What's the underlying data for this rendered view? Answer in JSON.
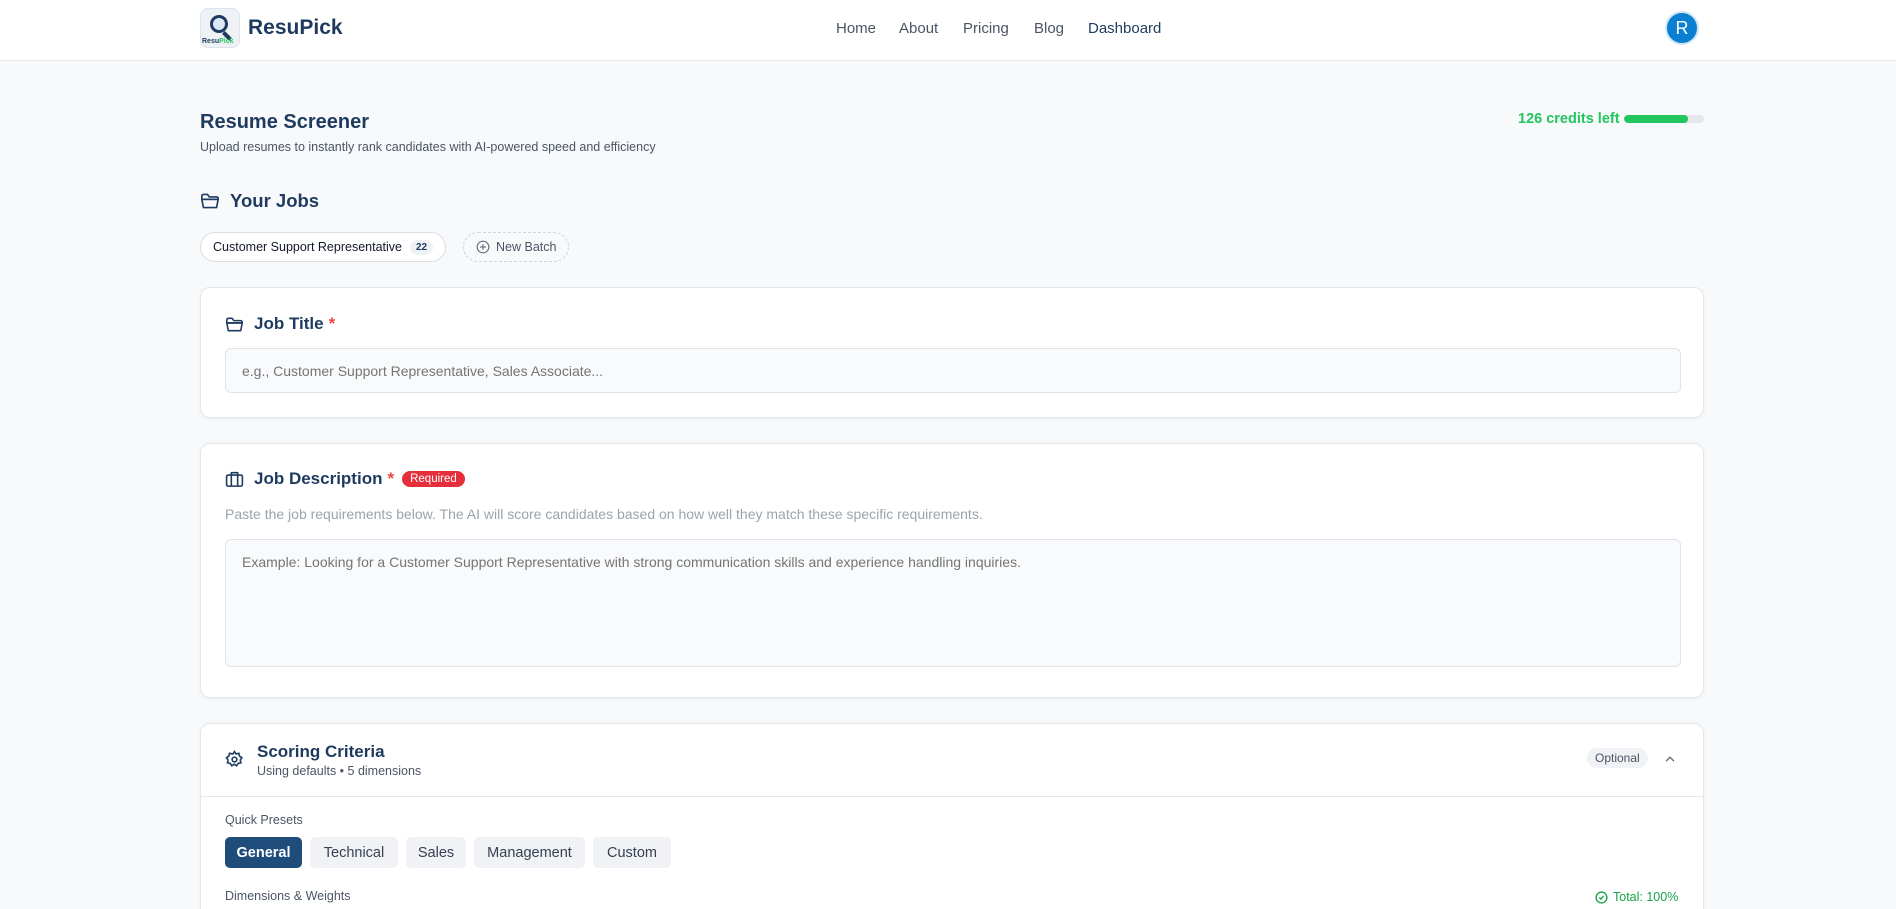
{
  "header": {
    "brand_name": "ResuPick",
    "logo_text_a": "Resu",
    "logo_text_b": "Pick",
    "nav": [
      "Home",
      "About",
      "Pricing",
      "Blog",
      "Dashboard"
    ],
    "active_nav": "Dashboard",
    "avatar_initial": "R"
  },
  "page": {
    "title": "Resume Screener",
    "subtitle": "Upload resumes to instantly rank candidates with AI-powered speed and efficiency",
    "credits_text": "126 credits left",
    "credits_fraction": 0.8
  },
  "jobs": {
    "heading": "Your Jobs",
    "items": [
      {
        "label": "Customer Support Representative",
        "count": "22"
      }
    ],
    "new_batch_label": "New Batch"
  },
  "job_title": {
    "label": "Job Title",
    "required_mark": "*",
    "placeholder": "e.g., Customer Support Representative, Sales Associate..."
  },
  "job_description": {
    "label": "Job Description",
    "required_mark": "*",
    "badge": "Required",
    "hint": "Paste the job requirements below. The AI will score candidates based on how well they match these specific requirements.",
    "placeholder": "Example: Looking for a Customer Support Representative with strong communication skills and experience handling inquiries."
  },
  "scoring": {
    "title": "Scoring Criteria",
    "subtitle": "Using defaults • 5 dimensions",
    "optional_badge": "Optional",
    "presets_label": "Quick Presets",
    "presets": [
      "General",
      "Technical",
      "Sales",
      "Management",
      "Custom"
    ],
    "active_preset": "General",
    "dimensions_label": "Dimensions & Weights",
    "total_text": "Total: 100%"
  },
  "colors": {
    "brand": "#1e3a5f",
    "success": "#22c55e",
    "required": "#e52f3a",
    "avatar": "#0b7fd1"
  },
  "icons": [
    "folder-icon",
    "briefcase-icon",
    "gear-icon",
    "plus-circle-icon",
    "chevron-up-icon",
    "check-circle-icon"
  ]
}
